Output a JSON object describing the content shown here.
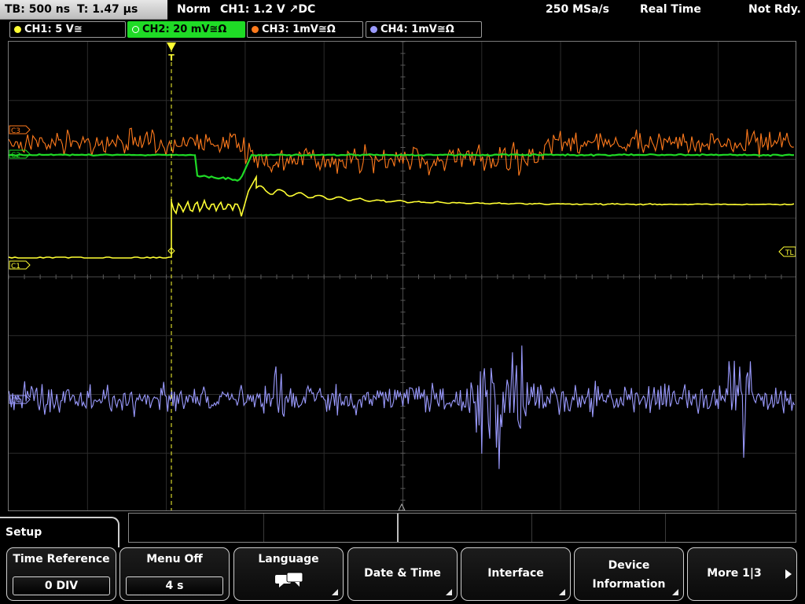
{
  "status": {
    "timebase": "TB: 500 ns",
    "trigger_time": "T: 1.47 µs",
    "mode": "Norm",
    "trigger_setting": "CH1: 1.2 V ↗DC",
    "sample_rate": "250 MSa/s",
    "acq_mode": "Real Time",
    "state": "Not Rdy."
  },
  "channels": [
    {
      "label": "CH1: 5 V≅",
      "color": "#ffff33"
    },
    {
      "label": "CH2: 20 mV≅Ω",
      "color": "#1fdb26"
    },
    {
      "label": "CH3: 1mV≅Ω",
      "color": "#ff7a1c"
    },
    {
      "label": "CH4: 1mV≅Ω",
      "color": "#9b9bff"
    }
  ],
  "scope": {
    "ch3_marker": "C3",
    "ch2_marker": "C2",
    "ch1_marker": "C1",
    "ch4_marker": "C4",
    "trigger_level_marker": "TL",
    "trigger_marker": "T",
    "grid": true
  },
  "menu": {
    "title": "Setup",
    "softkeys": [
      {
        "title": "Time Reference",
        "value": "0 DIV"
      },
      {
        "title": "Menu Off",
        "value": "4 s"
      },
      {
        "title": "Language",
        "icon": "speech-bubbles-icon"
      },
      {
        "label": "Date & Time"
      },
      {
        "label": "Interface"
      },
      {
        "line1": "Device",
        "line2": "Information"
      },
      {
        "label": "More 1|3"
      }
    ]
  }
}
